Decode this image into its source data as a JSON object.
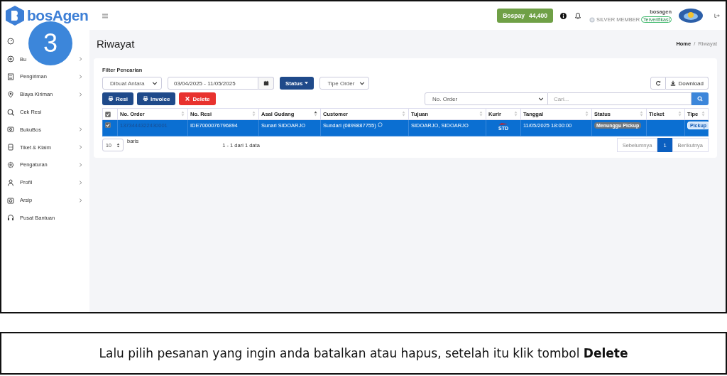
{
  "logo": {
    "name": "bosAgen"
  },
  "step_badge": "3",
  "header": {
    "balance_label": "Bospay",
    "balance": "44,400",
    "username": "bosagen",
    "membership": "SILVER MEMBER",
    "verified": "Terverifikasi"
  },
  "sidebar": {
    "items": [
      {
        "expandable": false
      },
      {
        "label": "Bu",
        "expandable": true
      },
      {
        "label": "Pengiriman",
        "expandable": true
      },
      {
        "label": "Biaya Kiriman",
        "expandable": true
      },
      {
        "label": "Cek Resi",
        "expandable": false
      },
      {
        "label": "BukuBos",
        "expandable": true
      },
      {
        "label": "Tiket & Klaim",
        "expandable": true
      },
      {
        "label": "Pengaturan",
        "expandable": true
      },
      {
        "label": "Profil",
        "expandable": true
      },
      {
        "label": "Arsip",
        "expandable": true
      },
      {
        "label": "Pusat Bantuan",
        "expandable": false
      }
    ]
  },
  "page": {
    "title": "Riwayat",
    "breadcrumb": [
      "Home",
      "Riwayat"
    ],
    "breadcrumb_separator": "/"
  },
  "filter": {
    "label": "Filter Pencarian",
    "date_type": "Dibuat Antara",
    "date_range": "03/04/2025 - 11/05/2025",
    "status_button": "Status",
    "order_type": "Tipe Order"
  },
  "actions": [
    {
      "label": "Resi",
      "kind": "print"
    },
    {
      "label": "Invoice",
      "kind": "print"
    },
    {
      "label": "Delete",
      "kind": "delete"
    }
  ],
  "download": "Download",
  "search": {
    "field": "No. Order",
    "placeholder": "Cari..."
  },
  "table": {
    "select_all": true,
    "columns": [
      {
        "label": "No. Order",
        "sorted": false
      },
      {
        "label": "No. Resi",
        "sorted": false
      },
      {
        "label": "Asal Gudang",
        "sorted": true
      },
      {
        "label": "Customer",
        "sorted": false
      },
      {
        "label": "Tujuan",
        "sorted": false
      },
      {
        "label": "Kurir",
        "sorted": false
      },
      {
        "label": "Tanggal",
        "sorted": false
      },
      {
        "label": "Status",
        "sorted": false
      },
      {
        "label": "Ticket",
        "sorted": false
      },
      {
        "label": "Tipe",
        "sorted": false
      }
    ],
    "rows": [
      {
        "selected": true,
        "checked": true,
        "no_order": "1373444322430001",
        "no_resi": "IDE7000076796894",
        "asal_gudang": "Sunari SIDOARJO",
        "customer": "Sundari (0899887755)",
        "tujuan": "SIDOARJO, SIDOARJO",
        "kurir": "STD",
        "tanggal": "11/05/2025 18:00:00",
        "status": "Menunggu Pickup",
        "tipe": "Pickup"
      }
    ]
  },
  "pagination": {
    "page_size": "10",
    "page_size_label": "baris",
    "info": "1 - 1 dari 1 data",
    "prev": "Sebelumnya",
    "pages": [
      {
        "label": "1",
        "selected": true
      }
    ],
    "next": "Berikutnya"
  },
  "caption": "Lalu pilih pesanan yang ingin anda batalkan atau hapus, setelah itu klik tombol **Delete**"
}
